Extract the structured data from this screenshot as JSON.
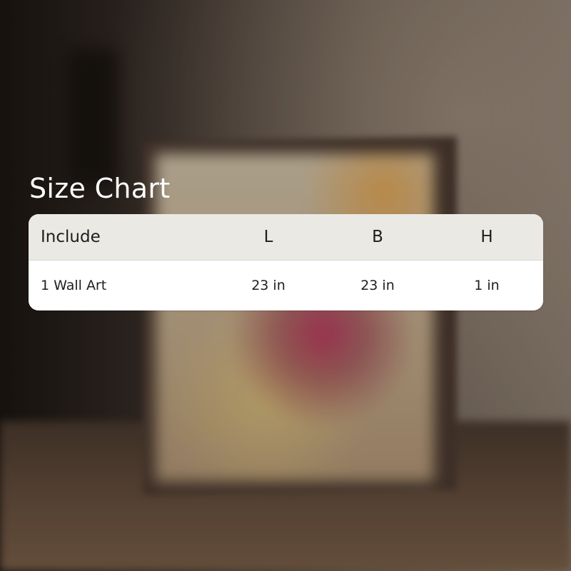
{
  "title": "Size Chart",
  "table": {
    "headers": [
      "Include",
      "L",
      "B",
      "H"
    ],
    "rows": [
      [
        "1 Wall Art",
        "23 in",
        "23 in",
        "1 in"
      ]
    ]
  },
  "colors": {
    "title_text": "#ffffff",
    "header_bg": "#ebe9e4",
    "row_bg": "#ffffff",
    "cell_text": "#1e1e1e"
  }
}
